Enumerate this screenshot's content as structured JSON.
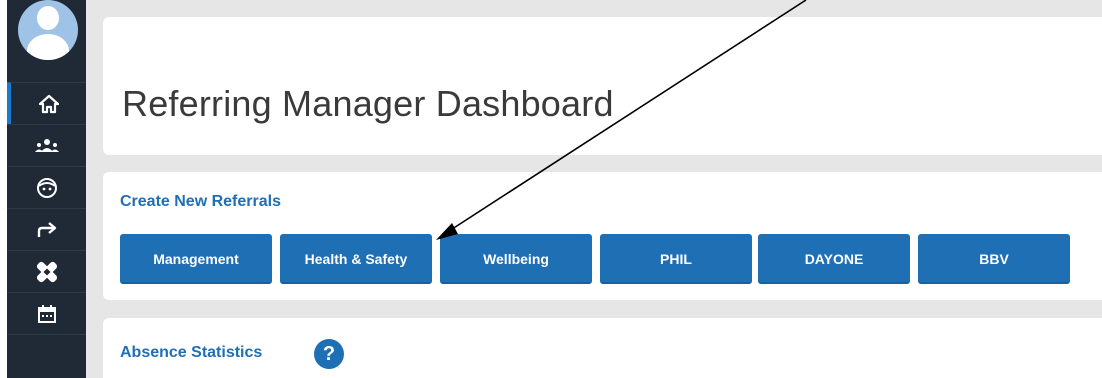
{
  "sidebar": {
    "avatar": "user-avatar",
    "items": [
      {
        "icon": "home-icon",
        "active": true
      },
      {
        "icon": "team-icon",
        "active": false
      },
      {
        "icon": "face-icon",
        "active": false
      },
      {
        "icon": "forward-arrow-icon",
        "active": false
      },
      {
        "icon": "bandage-icon",
        "active": false
      },
      {
        "icon": "calendar-icon",
        "active": false
      }
    ]
  },
  "header": {
    "title": "Referring Manager Dashboard"
  },
  "referrals": {
    "heading": "Create New Referrals",
    "buttons": [
      {
        "label": "Management"
      },
      {
        "label": "Health & Safety"
      },
      {
        "label": "Wellbeing"
      },
      {
        "label": "PHIL"
      },
      {
        "label": "DAYONE"
      },
      {
        "label": "BBV"
      }
    ]
  },
  "absence": {
    "heading": "Absence Statistics",
    "help_icon": "?"
  },
  "colors": {
    "accent": "#1f6fb5",
    "sidebar_bg": "#1f2a36",
    "page_bg": "#e6e6e6",
    "panel_bg": "#ffffff"
  }
}
